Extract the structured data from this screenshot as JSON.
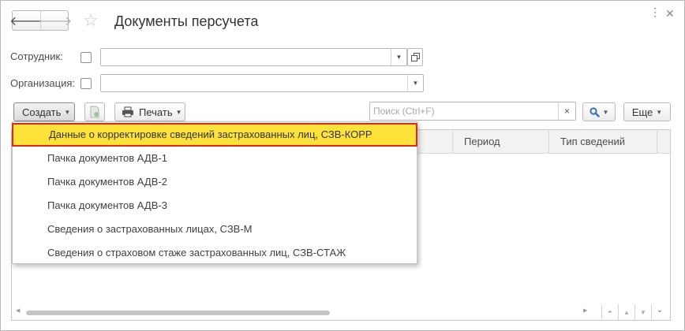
{
  "header": {
    "title": "Документы персучета",
    "back_icon": "arrow-left-icon",
    "forward_icon": "arrow-right-icon",
    "favorite_icon": "star-icon",
    "menu_icon": "more-icon",
    "close_icon": "close-icon"
  },
  "filters": {
    "employee": {
      "label": "Сотрудник:",
      "checked": false,
      "value": ""
    },
    "organization": {
      "label": "Организация:",
      "checked": false,
      "value": ""
    }
  },
  "toolbar": {
    "create_label": "Создать",
    "print_label": "Печать",
    "search_placeholder": "Поиск (Ctrl+F)",
    "search_clear": "×",
    "more_label": "Еще"
  },
  "table": {
    "columns": [
      "Период",
      "Тип сведений"
    ],
    "hscroll_position": 0.0
  },
  "dropdown": {
    "items": [
      {
        "label": "Данные о корректировке сведений застрахованных лиц, СЗВ-КОРР",
        "highlighted": true
      },
      {
        "label": "Пачка документов АДВ-1"
      },
      {
        "label": "Пачка документов АДВ-2"
      },
      {
        "label": "Пачка документов АДВ-3"
      },
      {
        "label": "Сведения о застрахованных лицах, СЗВ-М"
      },
      {
        "label": "Сведения о страховом стаже застрахованных лиц, СЗВ-СТАЖ"
      }
    ]
  },
  "colors": {
    "highlight_fill": "#fde23a",
    "highlight_border": "#e3271b",
    "search_icon": "#3a6fbf"
  }
}
